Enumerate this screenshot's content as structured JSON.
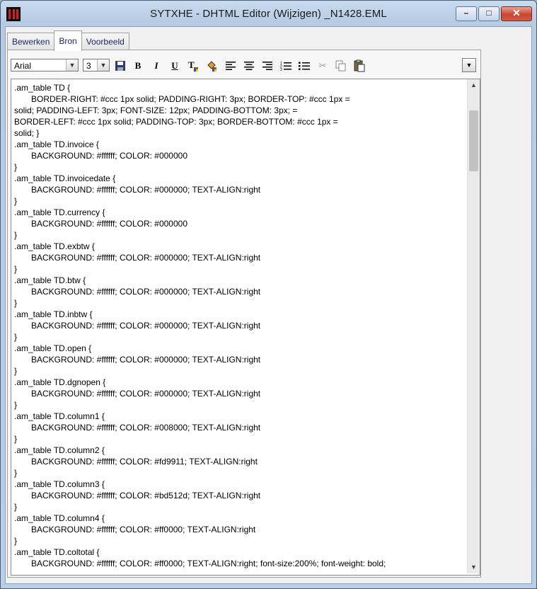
{
  "window": {
    "title": "SYTXHE - DHTML Editor (Wijzigen)                    _N1428.EML",
    "minimize_glyph": "–",
    "maximize_glyph": "□",
    "close_glyph": "✕"
  },
  "tabs": [
    {
      "label": "Bewerken"
    },
    {
      "label": "Bron",
      "active": true
    },
    {
      "label": "Voorbeeld"
    }
  ],
  "toolbar": {
    "font_value": "Arial",
    "size_value": "3",
    "icons": [
      "save-icon",
      "bold-icon",
      "italic-icon",
      "underline-icon",
      "text-color-icon",
      "highlight-color-icon",
      "align-left-icon",
      "align-center-icon",
      "align-right-icon",
      "numbered-list-icon",
      "bulleted-list-icon",
      "cut-icon",
      "copy-icon",
      "paste-icon"
    ],
    "bold_glyph": "B",
    "italic_glyph": "I",
    "underline_glyph": "U"
  },
  "editor": {
    "lines": [
      {
        "text": ".am_table TD {",
        "indent": false
      },
      {
        "text": "BORDER-RIGHT: #ccc 1px solid; PADDING-RIGHT: 3px; BORDER-TOP: #ccc 1px =",
        "indent": true
      },
      {
        "text": "solid; PADDING-LEFT: 3px; FONT-SIZE: 12px; PADDING-BOTTOM: 3px; =",
        "indent": false
      },
      {
        "text": "BORDER-LEFT: #ccc 1px solid; PADDING-TOP: 3px; BORDER-BOTTOM: #ccc 1px =",
        "indent": false
      },
      {
        "text": "solid; }",
        "indent": false
      },
      {
        "text": ".am_table TD.invoice {",
        "indent": false
      },
      {
        "text": "BACKGROUND: #ffffff; COLOR: #000000",
        "indent": true
      },
      {
        "text": "}",
        "indent": false
      },
      {
        "text": ".am_table TD.invoicedate {",
        "indent": false
      },
      {
        "text": "BACKGROUND: #ffffff; COLOR: #000000; TEXT-ALIGN:right",
        "indent": true
      },
      {
        "text": "}",
        "indent": false
      },
      {
        "text": ".am_table TD.currency {",
        "indent": false
      },
      {
        "text": "BACKGROUND: #ffffff; COLOR: #000000",
        "indent": true
      },
      {
        "text": "}",
        "indent": false
      },
      {
        "text": ".am_table TD.exbtw {",
        "indent": false
      },
      {
        "text": "BACKGROUND: #ffffff; COLOR: #000000; TEXT-ALIGN:right",
        "indent": true
      },
      {
        "text": "}",
        "indent": false
      },
      {
        "text": ".am_table TD.btw {",
        "indent": false
      },
      {
        "text": "BACKGROUND: #ffffff; COLOR: #000000; TEXT-ALIGN:right",
        "indent": true
      },
      {
        "text": "}",
        "indent": false
      },
      {
        "text": ".am_table TD.inbtw {",
        "indent": false
      },
      {
        "text": "BACKGROUND: #ffffff; COLOR: #000000; TEXT-ALIGN:right",
        "indent": true
      },
      {
        "text": "}",
        "indent": false
      },
      {
        "text": ".am_table TD.open {",
        "indent": false
      },
      {
        "text": "BACKGROUND: #ffffff; COLOR: #000000; TEXT-ALIGN:right",
        "indent": true
      },
      {
        "text": "}",
        "indent": false
      },
      {
        "text": ".am_table TD.dgnopen {",
        "indent": false
      },
      {
        "text": "BACKGROUND: #ffffff; COLOR: #000000; TEXT-ALIGN:right",
        "indent": true
      },
      {
        "text": "}",
        "indent": false
      },
      {
        "text": ".am_table TD.column1 {",
        "indent": false
      },
      {
        "text": "BACKGROUND: #ffffff; COLOR: #008000; TEXT-ALIGN:right",
        "indent": true
      },
      {
        "text": "}",
        "indent": false
      },
      {
        "text": ".am_table TD.column2 {",
        "indent": false
      },
      {
        "text": "BACKGROUND: #ffffff; COLOR: #fd9911; TEXT-ALIGN:right",
        "indent": true
      },
      {
        "text": "}",
        "indent": false
      },
      {
        "text": ".am_table TD.column3 {",
        "indent": false
      },
      {
        "text": "BACKGROUND: #ffffff; COLOR: #bd512d; TEXT-ALIGN:right",
        "indent": true
      },
      {
        "text": "}",
        "indent": false
      },
      {
        "text": ".am_table TD.column4 {",
        "indent": false
      },
      {
        "text": "BACKGROUND: #ffffff; COLOR: #ff0000; TEXT-ALIGN:right",
        "indent": true
      },
      {
        "text": "}",
        "indent": false
      },
      {
        "text": ".am_table TD.coltotal {",
        "indent": false
      },
      {
        "text": "BACKGROUND: #ffffff; COLOR: #ff0000; TEXT-ALIGN:right; font-size:200%; font-weight: bold;",
        "indent": true
      }
    ]
  },
  "colors": {
    "titlebar": "#c9daee",
    "close_button": "#c84631",
    "tab_text": "#1b2a6b"
  }
}
